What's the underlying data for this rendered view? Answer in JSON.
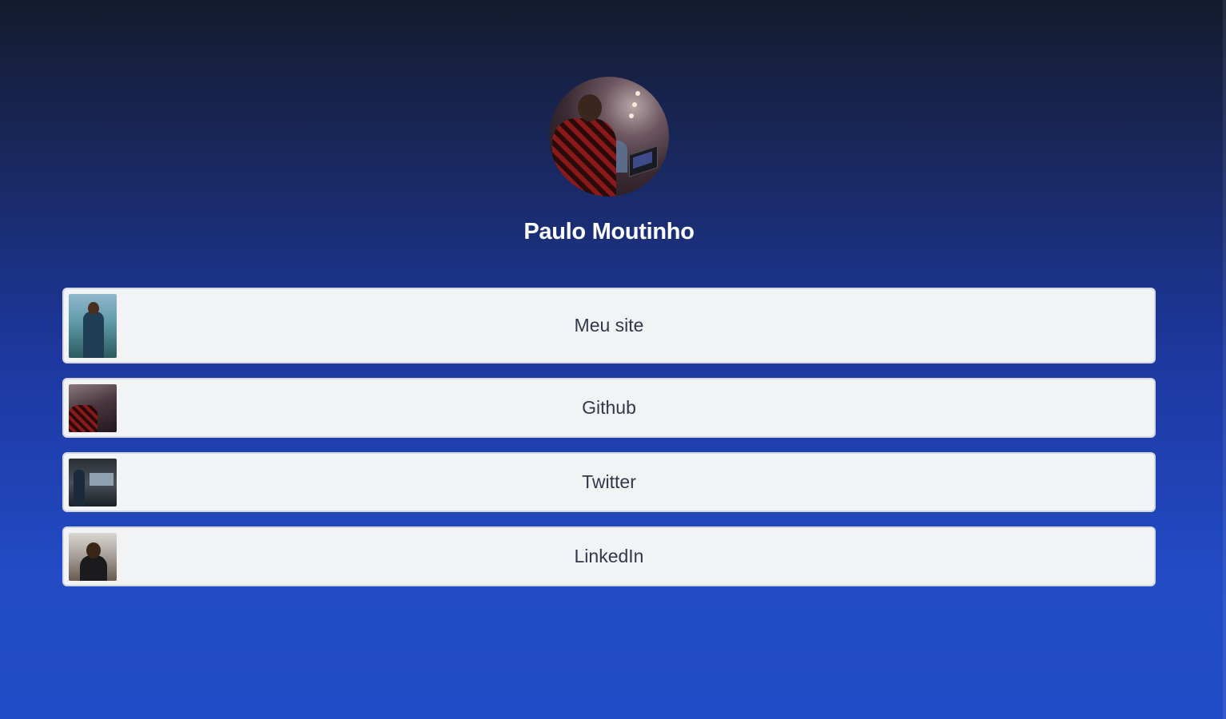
{
  "profile": {
    "name": "Paulo Moutinho",
    "avatar_icon": "profile-photo"
  },
  "links": [
    {
      "label": "Meu site",
      "thumbnail": "site-thumbnail"
    },
    {
      "label": "Github",
      "thumbnail": "github-thumbnail"
    },
    {
      "label": "Twitter",
      "thumbnail": "twitter-thumbnail"
    },
    {
      "label": "LinkedIn",
      "thumbnail": "linkedin-thumbnail"
    }
  ],
  "colors": {
    "background_top": "#141b2d",
    "background_bottom": "#234dc8",
    "card_background": "#f2f3f5",
    "card_text": "#30384a",
    "name_text": "#ffffff"
  }
}
